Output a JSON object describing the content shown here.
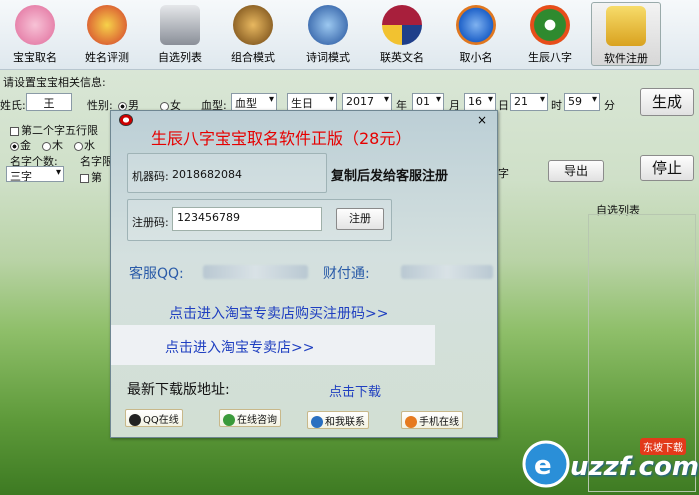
{
  "toolbar": {
    "items": [
      {
        "label": "宝宝取名",
        "icon": "baby-icon",
        "color": "#e06a9a"
      },
      {
        "label": "姓名评测",
        "icon": "gift-icon",
        "color": "#d23a2a"
      },
      {
        "label": "自选列表",
        "icon": "brush-cup-icon",
        "color": "#8a8f98"
      },
      {
        "label": "组合模式",
        "icon": "lion-icon",
        "color": "#9a6a28"
      },
      {
        "label": "诗词模式",
        "icon": "book-icon",
        "color": "#2a6fc0"
      },
      {
        "label": "联英文名",
        "icon": "barcelona-badge-icon",
        "color": "#a81f3c"
      },
      {
        "label": "取小名",
        "icon": "firefox-icon",
        "color": "#1f62c9"
      },
      {
        "label": "生辰八字",
        "icon": "bagua-icon",
        "color": "#2f8a2f"
      },
      {
        "label": "软件注册",
        "icon": "lock-icon",
        "color": "#e6b52a"
      }
    ]
  },
  "form": {
    "hint": "请设置宝宝相关信息:",
    "surname_label": "姓氏:",
    "surname": "王",
    "gender_label": "性别:",
    "male": "男",
    "female": "女",
    "blood_label": "血型:",
    "blood": "血型",
    "birth_type": "生日",
    "year": "2017",
    "year_unit": "年",
    "month": "01",
    "month_unit": "月",
    "day": "16",
    "day_unit": "日",
    "hour": "21",
    "hour_unit": "时",
    "minute": "59",
    "minute_unit": "分",
    "generate": "生成",
    "second_wuxing": "第二个字五行限",
    "wuxing_gold": "金",
    "wuxing_wood": "木",
    "wuxing_water": "水",
    "name_count_label": "名字个数:",
    "name_count": "三字",
    "name_limit_label": "名字限",
    "first_label": "第",
    "zi": "字",
    "export": "导出",
    "stop": "停止",
    "custom_list": "自选列表"
  },
  "dialog": {
    "title": "生辰八字宝宝取名软件正版（28元）",
    "close": "×",
    "machine_label": "机器码:",
    "machine_code": "2018682084",
    "copy_hint": "复制后发给客服注册",
    "reg_label": "注册码:",
    "reg_code": "123456789",
    "reg_button": "注册",
    "qq_label": "客服QQ:",
    "tenpay_label": "财付通:",
    "buy_link": "点击进入淘宝专卖店购买注册码>>",
    "shop_link": "点击进入淘宝专卖店>>",
    "download_label": "最新下载版地址:",
    "download_link": "点击下载",
    "badges": [
      "QQ在线",
      "在线咨询",
      "和我联系",
      "手机在线"
    ]
  },
  "watermark": {
    "text": "uzzf.com",
    "sub": "东坡下载"
  }
}
